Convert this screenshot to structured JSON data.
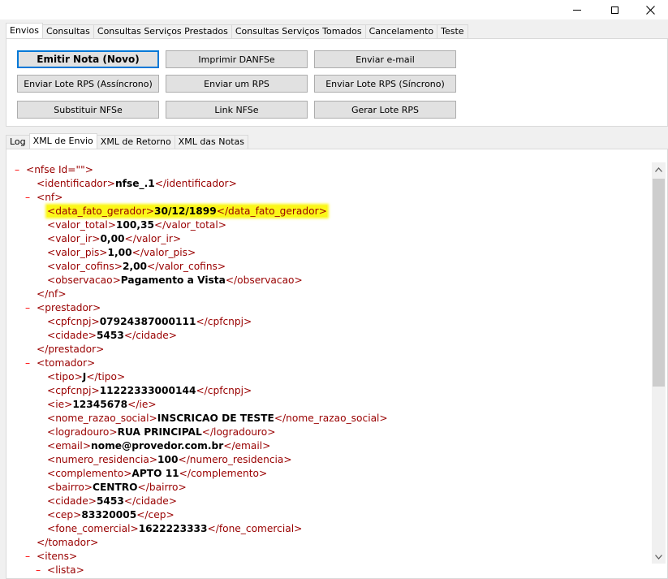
{
  "window": {
    "minimize": "—",
    "maximize": "☐",
    "close": "✕"
  },
  "top_tabs": [
    "Envios",
    "Consultas",
    "Consultas Serviços Prestados",
    "Consultas Serviços Tomados",
    "Cancelamento",
    "Teste"
  ],
  "buttons": {
    "emitir_nota": "Emitir Nota (Novo)",
    "imprimir_danfse": "Imprimir DANFSe",
    "enviar_email": "Enviar e-mail",
    "enviar_lote_assincrono": "Enviar Lote RPS (Assíncrono)",
    "enviar_um_rps": "Enviar um RPS",
    "enviar_lote_sincrono": "Enviar Lote RPS (Síncrono)",
    "substituir_nfse": "Substituir NFSe",
    "link_nfse": "Link NFSe",
    "gerar_lote_rps": "Gerar Lote RPS"
  },
  "sub_tabs": [
    "Log",
    "XML de Envio",
    "XML de Retorno",
    "XML das Notas"
  ],
  "xml_lines": [
    {
      "t": "-",
      "tag": "nfse Id=\"\""
    },
    {
      "tag": "identificador",
      "v": "nfse_.1"
    },
    {
      "t": "-",
      "tag": "nf"
    },
    {
      "tag": "data_fato_gerador",
      "v": "30/12/1899",
      "hl": true
    },
    {
      "tag": "valor_total",
      "v": "100,35"
    },
    {
      "tag": "valor_ir",
      "v": "0,00"
    },
    {
      "tag": "valor_pis",
      "v": "1,00"
    },
    {
      "tag": "valor_cofins",
      "v": "2,00"
    },
    {
      "tag": "observacao",
      "v": "Pagamento a Vista"
    },
    {
      "close": "nf"
    },
    {
      "t": "-",
      "tag": "prestador"
    },
    {
      "tag": "cpfcnpj",
      "v": "07924387000111"
    },
    {
      "tag": "cidade",
      "v": "5453"
    },
    {
      "close": "prestador"
    },
    {
      "t": "-",
      "tag": "tomador"
    },
    {
      "tag": "tipo",
      "v": "J"
    },
    {
      "tag": "cpfcnpj",
      "v": "11222333000144"
    },
    {
      "tag": "ie",
      "v": "12345678"
    },
    {
      "tag": "nome_razao_social",
      "v": "INSCRICAO DE TESTE"
    },
    {
      "tag": "logradouro",
      "v": "RUA PRINCIPAL"
    },
    {
      "tag": "email",
      "v": "nome@provedor.com.br"
    },
    {
      "tag": "numero_residencia",
      "v": "100"
    },
    {
      "tag": "complemento",
      "v": "APTO 11"
    },
    {
      "tag": "bairro",
      "v": "CENTRO"
    },
    {
      "tag": "cidade",
      "v": "5453"
    },
    {
      "tag": "cep",
      "v": "83320005"
    },
    {
      "tag": "fone_comercial",
      "v": "1622223333"
    },
    {
      "close": "tomador"
    },
    {
      "t": "-",
      "tag": "itens"
    },
    {
      "t": "-",
      "tag": "lista"
    }
  ],
  "highlight_color": "#fbf718",
  "tag_color": "#990000",
  "toggle_color": "#ff0000"
}
